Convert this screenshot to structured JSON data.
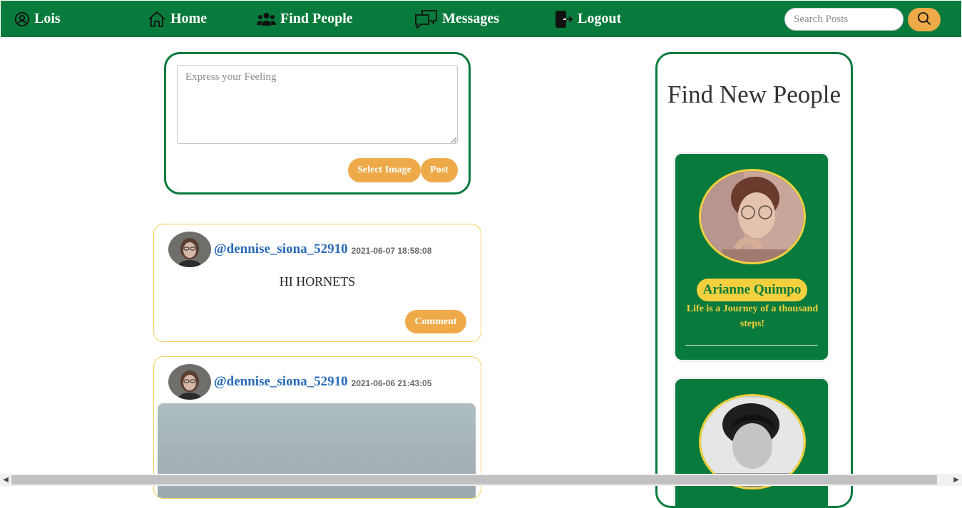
{
  "colors": {
    "nav_green": "#087a3c",
    "accent_orange": "#eea948",
    "gold": "#f4d03f",
    "link_blue": "#2a6bb8"
  },
  "nav": {
    "user": {
      "label": "Lois",
      "icon": "user-circle-icon"
    },
    "home": {
      "label": "Home",
      "icon": "house-icon"
    },
    "find_people": {
      "label": "Find People",
      "icon": "people-icon"
    },
    "messages": {
      "label": "Messages",
      "icon": "chat-bubbles-icon"
    },
    "logout": {
      "label": "Logout",
      "icon": "logout-icon"
    },
    "search": {
      "placeholder": "Search Posts",
      "value": "",
      "button_icon": "magnifier-icon"
    }
  },
  "composer": {
    "placeholder": "Express your Feeling",
    "value": "",
    "select_image_label": "Select Image",
    "post_label": "Post"
  },
  "posts": [
    {
      "handle": "@dennise_siona_52910",
      "timestamp": "2021-06-07 18:58:08",
      "text": "HI HORNETS",
      "comment_label": "Comment"
    },
    {
      "handle": "@dennise_siona_52910",
      "timestamp": "2021-06-06 21:43:05",
      "text": "",
      "has_image": true
    }
  ],
  "sidebar": {
    "title": "Find New People",
    "people": [
      {
        "name": "Arianne Quimpo",
        "bio": "Life is a Journey of a thousand steps!"
      },
      {
        "name": "",
        "bio": ""
      }
    ]
  }
}
